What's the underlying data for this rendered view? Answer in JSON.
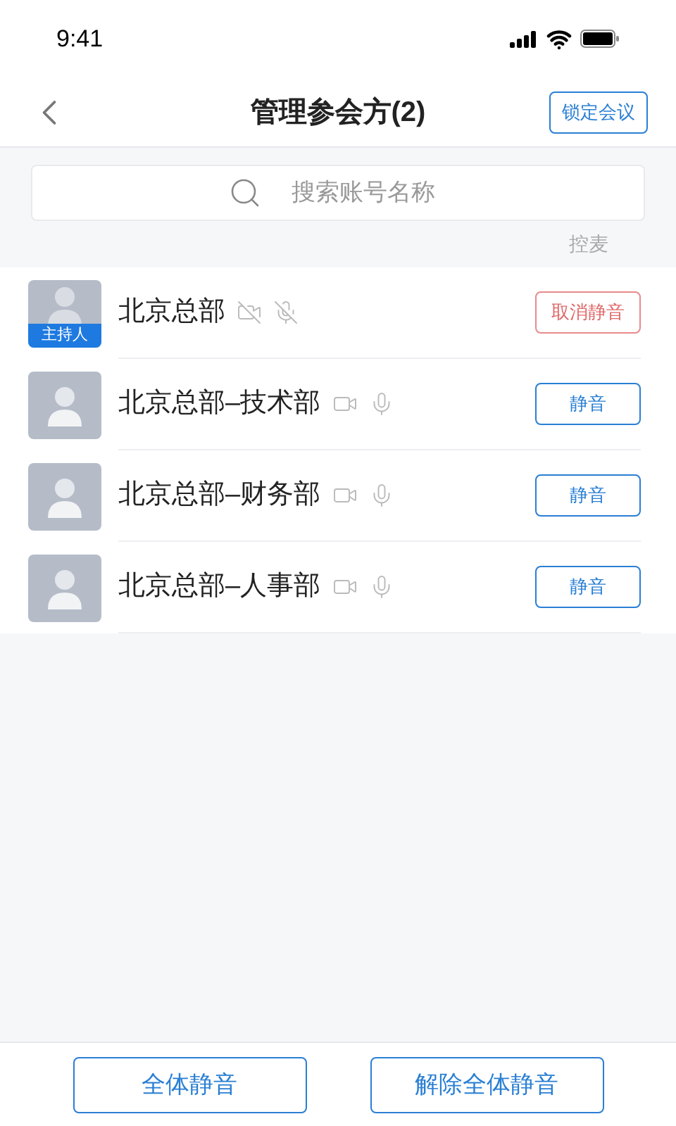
{
  "status_bar": {
    "time": "9:41"
  },
  "header": {
    "title": "管理参会方(2)",
    "action": "锁定会议"
  },
  "search": {
    "placeholder": "搜索账号名称"
  },
  "section_action": "控麦",
  "participants": [
    {
      "name": "北京总部",
      "badge": "主持人",
      "camera_on": false,
      "mic_on": false,
      "button": {
        "label": "取消静音",
        "kind": "unmute"
      }
    },
    {
      "name": "北京总部–技术部",
      "camera_on": true,
      "mic_on": true,
      "button": {
        "label": "静音",
        "kind": "mute"
      }
    },
    {
      "name": "北京总部–财务部",
      "camera_on": true,
      "mic_on": true,
      "button": {
        "label": "静音",
        "kind": "mute"
      }
    },
    {
      "name": "北京总部–人事部",
      "camera_on": true,
      "mic_on": true,
      "button": {
        "label": "静音",
        "kind": "mute"
      }
    }
  ],
  "footer_buttons": [
    "全体静音",
    "解除全体静音"
  ]
}
